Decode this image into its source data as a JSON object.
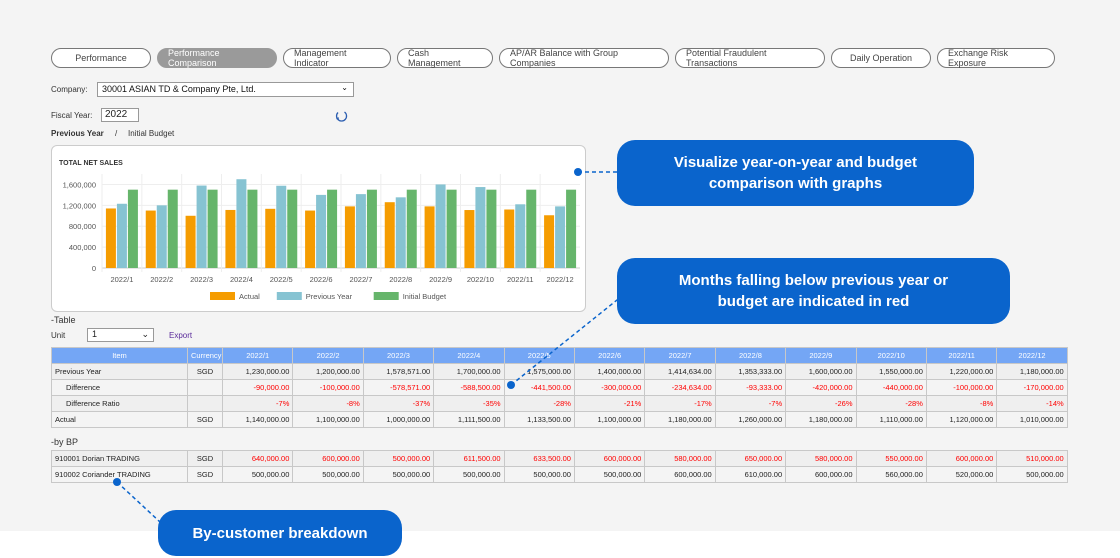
{
  "tabs": [
    "Performance",
    "Performance Comparison",
    "Management Indicator",
    "Cash Management",
    "AP/AR Balance with Group Companies",
    "Potential Fraudulent Transactions",
    "Daily Operation",
    "Exchange Risk Exposure"
  ],
  "active_tab": 1,
  "company_label": "Company:",
  "company_value": "30001 ASIAN TD & Company Pte, Ltd.",
  "fiscal_label": "Fiscal Year:",
  "fiscal_value": "2022",
  "compare": {
    "a": "Previous Year",
    "sep": "/",
    "b": "Initial Budget"
  },
  "chart_data": {
    "type": "bar",
    "title": "TOTAL NET SALES",
    "categories": [
      "2022/1",
      "2022/2",
      "2022/3",
      "2022/4",
      "2022/5",
      "2022/6",
      "2022/7",
      "2022/8",
      "2022/9",
      "2022/10",
      "2022/11",
      "2022/12"
    ],
    "ylim": [
      0,
      1800000
    ],
    "yticks": [
      "0",
      "400,000",
      "800,000",
      "1,200,000",
      "1,600,000"
    ],
    "grid": true,
    "legend": "bottom",
    "series": [
      {
        "name": "Actual",
        "color": "#f59c00",
        "values": [
          1140000,
          1100000,
          1000000,
          1111500,
          1133500,
          1100000,
          1180000,
          1260000,
          1180000,
          1110000,
          1120000,
          1010000
        ]
      },
      {
        "name": "Previous Year",
        "color": "#86c3d2",
        "values": [
          1230000,
          1200000,
          1578571,
          1700000,
          1575000,
          1400000,
          1414634,
          1353333,
          1600000,
          1550000,
          1220000,
          1180000
        ]
      },
      {
        "name": "Initial Budget",
        "color": "#66b56b",
        "values": [
          1500000,
          1500000,
          1500000,
          1500000,
          1500000,
          1500000,
          1500000,
          1500000,
          1500000,
          1500000,
          1500000,
          1500000
        ]
      }
    ]
  },
  "table_title": "-Table",
  "unit_label": "Unit",
  "unit_value": "1",
  "export_label": "Export",
  "table": {
    "headers": [
      "Item",
      "Currency",
      "2022/1",
      "2022/2",
      "2022/3",
      "2022/4",
      "2022/5",
      "2022/6",
      "2022/7",
      "2022/8",
      "2022/9",
      "2022/10",
      "2022/11",
      "2022/12"
    ],
    "rows": [
      {
        "item": "Previous Year",
        "cur": "SGD",
        "red": false,
        "indent": false,
        "vals": [
          "1,230,000.00",
          "1,200,000.00",
          "1,578,571.00",
          "1,700,000.00",
          "1,575,000.00",
          "1,400,000.00",
          "1,414,634.00",
          "1,353,333.00",
          "1,600,000.00",
          "1,550,000.00",
          "1,220,000.00",
          "1,180,000.00"
        ]
      },
      {
        "item": "Difference",
        "cur": "",
        "red": true,
        "indent": true,
        "vals": [
          "-90,000.00",
          "-100,000.00",
          "-578,571.00",
          "-588,500.00",
          "-441,500.00",
          "-300,000.00",
          "-234,634.00",
          "-93,333.00",
          "-420,000.00",
          "-440,000.00",
          "-100,000.00",
          "-170,000.00"
        ]
      },
      {
        "item": "Difference Ratio",
        "cur": "",
        "red": true,
        "indent": true,
        "vals": [
          "-7%",
          "-8%",
          "-37%",
          "-35%",
          "-28%",
          "-21%",
          "-17%",
          "-7%",
          "-26%",
          "-28%",
          "-8%",
          "-14%"
        ]
      },
      {
        "item": "Actual",
        "cur": "SGD",
        "red": false,
        "indent": false,
        "vals": [
          "1,140,000.00",
          "1,100,000.00",
          "1,000,000.00",
          "1,111,500.00",
          "1,133,500.00",
          "1,100,000.00",
          "1,180,000.00",
          "1,260,000.00",
          "1,180,000.00",
          "1,110,000.00",
          "1,120,000.00",
          "1,010,000.00"
        ]
      }
    ]
  },
  "bp_title": "-by BP",
  "bp_rows": [
    {
      "item": "910001 Dorian TRADING",
      "cur": "SGD",
      "red": true,
      "indent": false,
      "vals": [
        "640,000.00",
        "600,000.00",
        "500,000.00",
        "611,500.00",
        "633,500.00",
        "600,000.00",
        "580,000.00",
        "650,000.00",
        "580,000.00",
        "550,000.00",
        "600,000.00",
        "510,000.00"
      ]
    },
    {
      "item": "910002 Coriander TRADING",
      "cur": "SGD",
      "red": false,
      "indent": false,
      "vals": [
        "500,000.00",
        "500,000.00",
        "500,000.00",
        "500,000.00",
        "500,000.00",
        "500,000.00",
        "600,000.00",
        "610,000.00",
        "600,000.00",
        "560,000.00",
        "520,000.00",
        "500,000.00"
      ]
    }
  ],
  "callouts": [
    "Visualize year-on-year and budget comparison with graphs",
    "Months falling below previous year or budget are indicated in red",
    "By-customer breakdown"
  ],
  "accent": "#0a64cc"
}
